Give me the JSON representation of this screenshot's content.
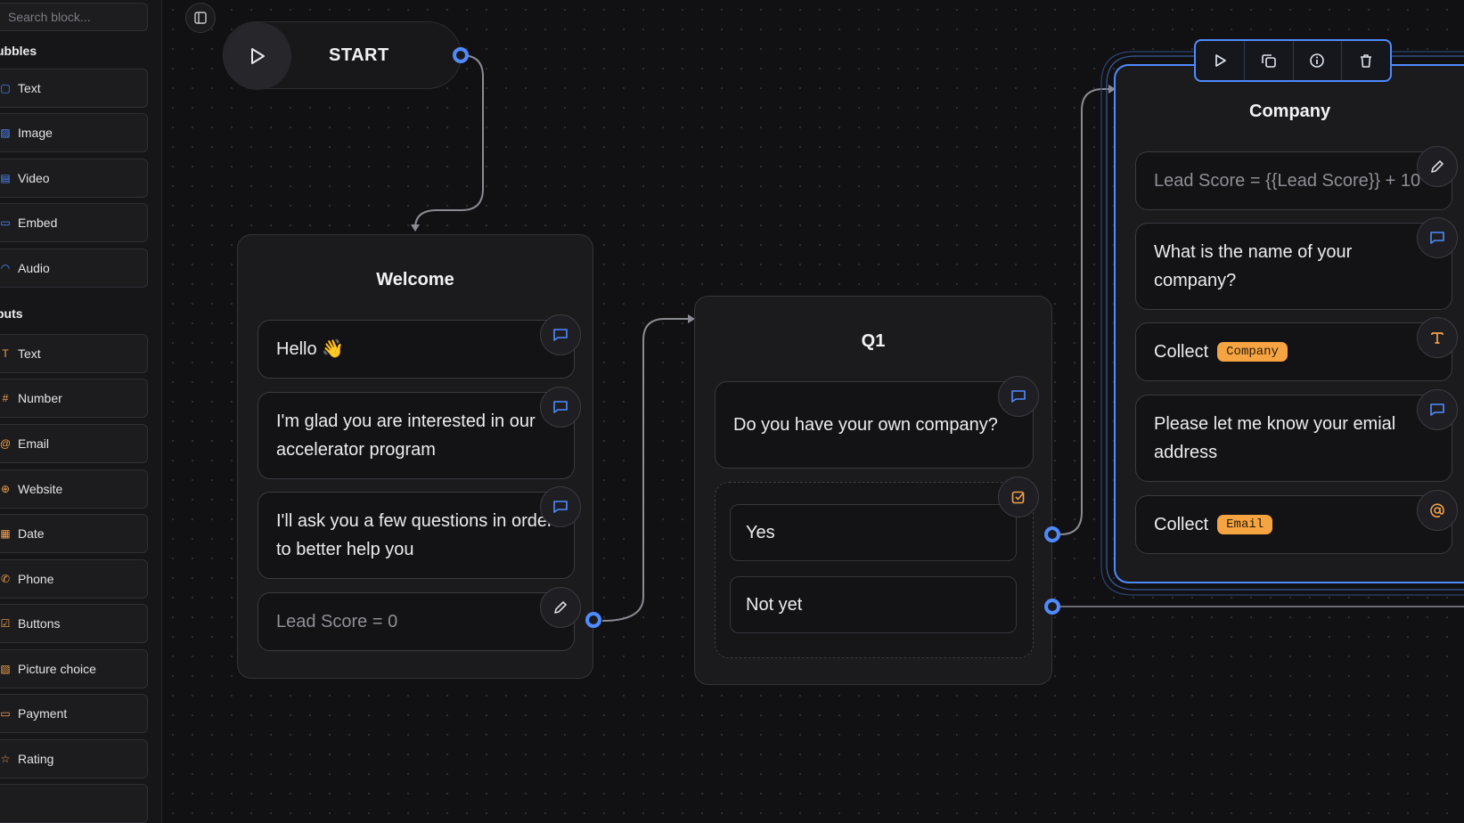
{
  "sidebar": {
    "search_placeholder": "Search block...",
    "sections": [
      {
        "title": "ubbles",
        "items": [
          {
            "label": "Text",
            "icon": "chat-icon",
            "glyph": "▢"
          },
          {
            "label": "Image",
            "icon": "image-icon",
            "glyph": "▨"
          },
          {
            "label": "Video",
            "icon": "video-icon",
            "glyph": "▤"
          },
          {
            "label": "Embed",
            "icon": "embed-icon",
            "glyph": "▭"
          },
          {
            "label": "Audio",
            "icon": "audio-icon",
            "glyph": "◠"
          }
        ]
      },
      {
        "title": "puts",
        "items": [
          {
            "label": "Text",
            "icon": "text-input-icon",
            "glyph": "T"
          },
          {
            "label": "Number",
            "icon": "number-icon",
            "glyph": "#"
          },
          {
            "label": "Email",
            "icon": "at-icon",
            "glyph": "@"
          },
          {
            "label": "Website",
            "icon": "globe-icon",
            "glyph": "⊕"
          },
          {
            "label": "Date",
            "icon": "calendar-icon",
            "glyph": "▦"
          },
          {
            "label": "Phone",
            "icon": "phone-icon",
            "glyph": "✆"
          },
          {
            "label": "Buttons",
            "icon": "checkbox-icon",
            "glyph": "☑"
          },
          {
            "label": "Picture choice",
            "icon": "picture-icon",
            "glyph": "▧"
          },
          {
            "label": "Payment",
            "icon": "card-icon",
            "glyph": "▭"
          },
          {
            "label": "Rating",
            "icon": "star-icon",
            "glyph": "☆"
          }
        ]
      }
    ]
  },
  "canvas": {
    "start": {
      "label": "START"
    },
    "groups": {
      "welcome": {
        "title": "Welcome",
        "blocks": [
          {
            "text": "Hello 👋",
            "icon": "chat-bubble-icon"
          },
          {
            "text": "I'm glad you are interested in our accelerator program",
            "icon": "chat-bubble-icon"
          },
          {
            "text": "I'll ask you a few questions in order to better help you",
            "icon": "chat-bubble-icon"
          },
          {
            "text": "Lead Score = 0",
            "icon": "pencil-icon"
          }
        ]
      },
      "q1": {
        "title": "Q1",
        "question": "Do you have your own company?",
        "choices": [
          "Yes",
          "Not yet"
        ]
      },
      "company": {
        "title": "Company",
        "set_variable": "Lead Score = {{Lead Score}} + 10",
        "question_name": "What is the name of your company?",
        "collect_label": "Collect",
        "company_var": "Company",
        "question_email": "Please let me know your emial address",
        "email_var": "Email"
      }
    }
  },
  "colors": {
    "accent": "#4f8bff",
    "tag": "#f6a441",
    "input_icon": "#f2a04a"
  }
}
